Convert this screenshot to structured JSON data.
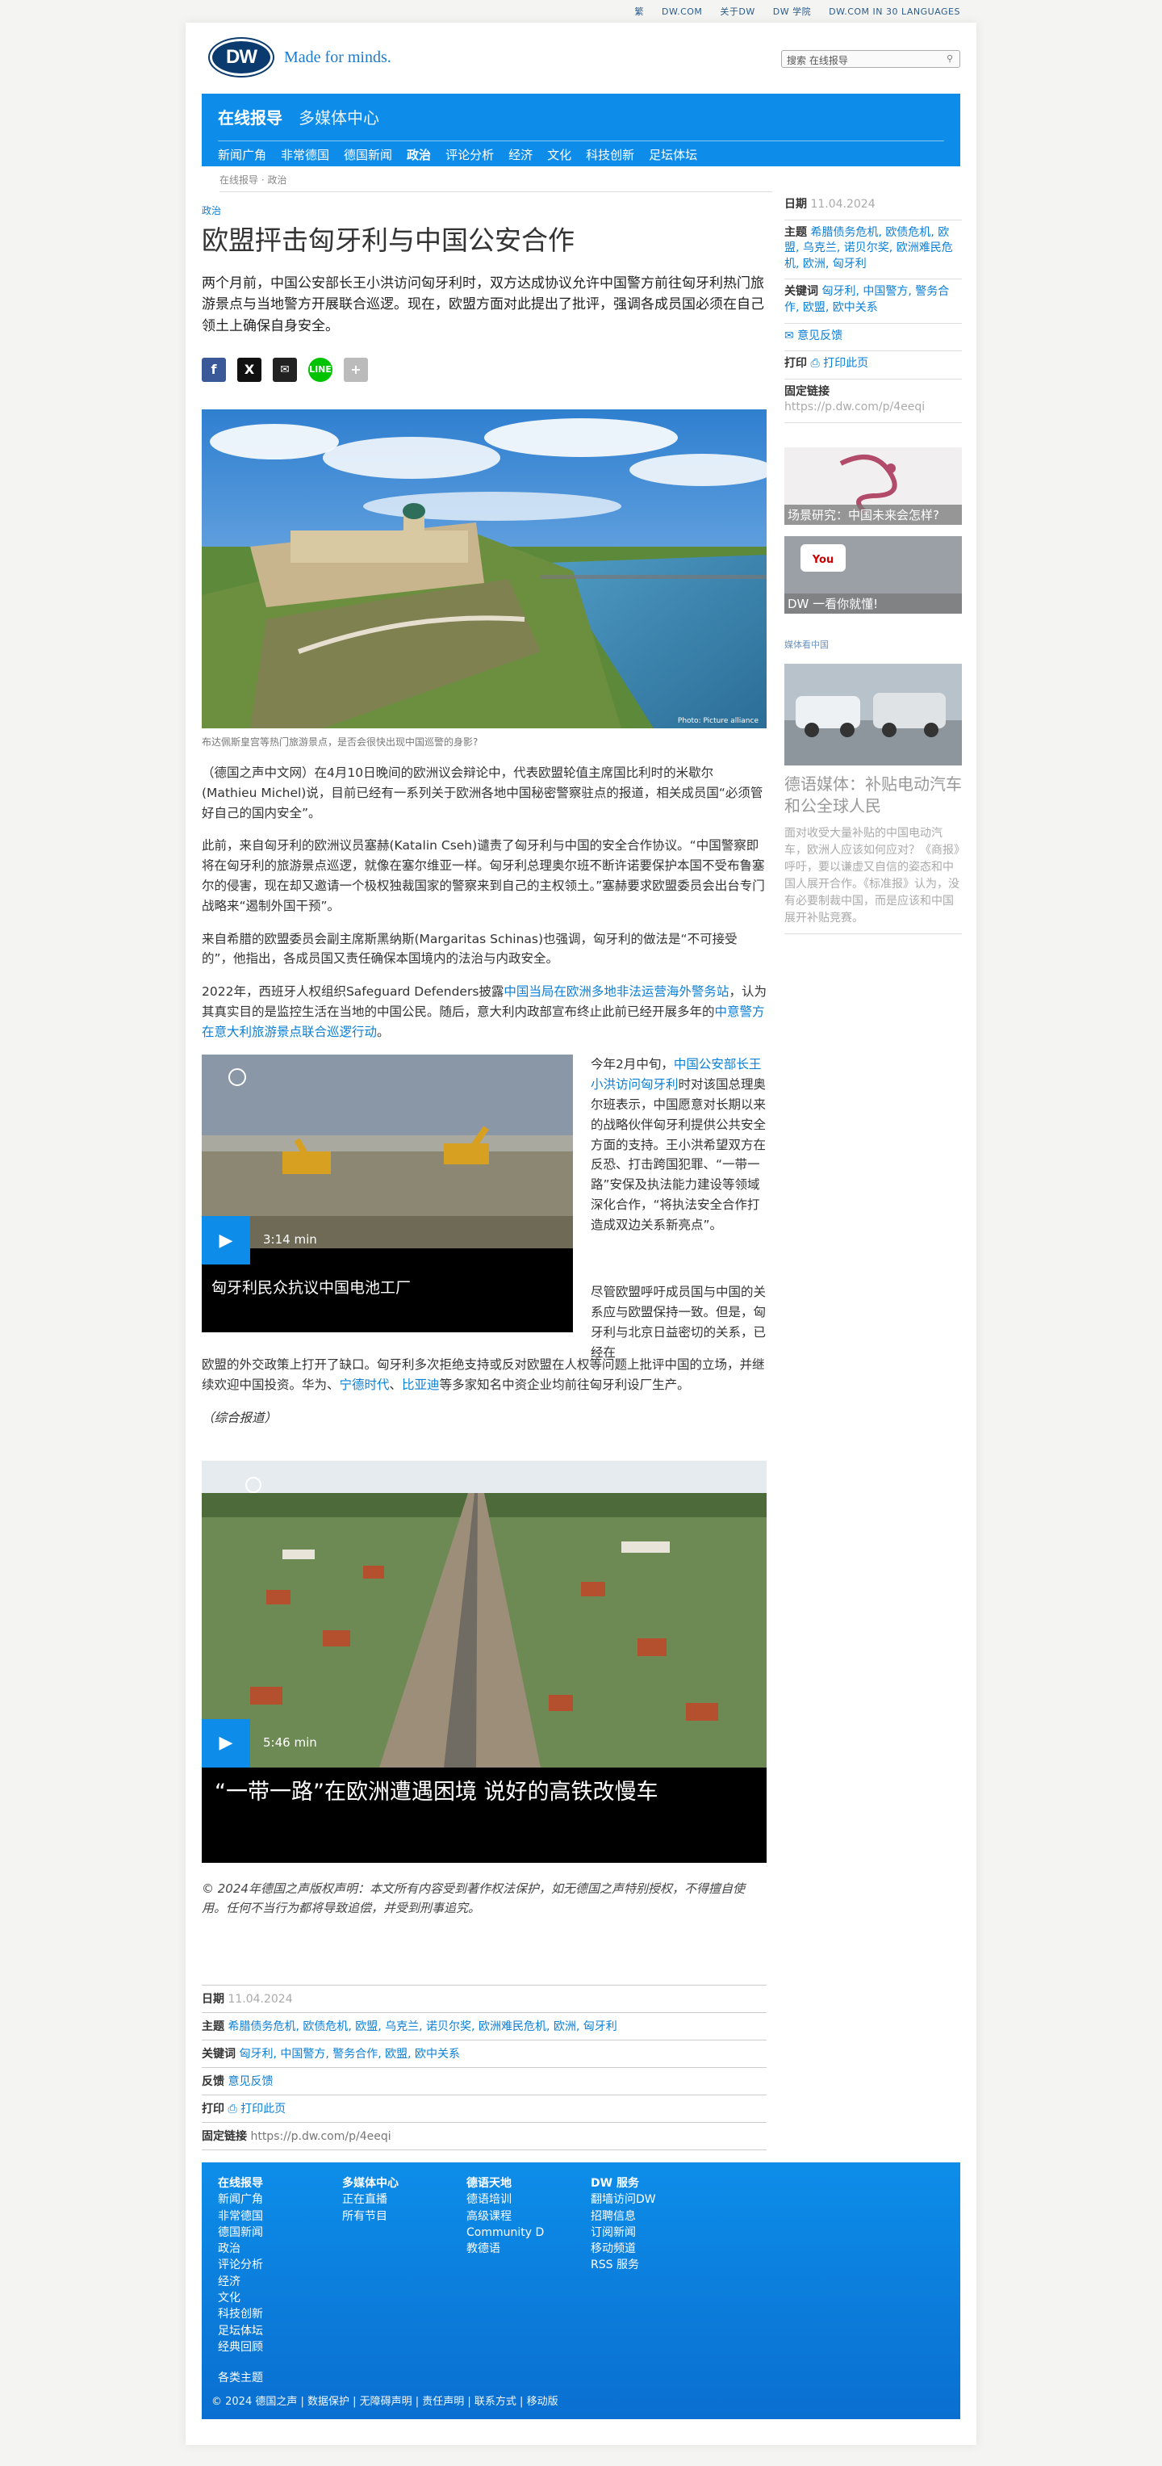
{
  "topbar": {
    "l1": "繁",
    "l2": "DW.COM",
    "l3": "关于DW",
    "l4": "DW 学院",
    "l5": "DW.COM IN 30 LANGUAGES"
  },
  "header": {
    "logo": "DW",
    "tagline": "Made for minds.",
    "search_placeholder": "搜索 在线报导"
  },
  "nav": {
    "main": "在线报导",
    "media": "多媒体中心",
    "subs": [
      "新闻广角",
      "非常德国",
      "德国新闻",
      "政治",
      "评论分析",
      "经济",
      "文化",
      "科技创新",
      "足坛体坛"
    ]
  },
  "breadcrumb": "在线报导 · 政治",
  "article": {
    "kicker": "政治",
    "title": "欧盟抨击匈牙利与中国公安合作",
    "lead": "两个月前，中国公安部长王小洪访问匈牙利时，双方达成协议允许中国警方前往匈牙利热门旅游景点与当地警方开展联合巡逻。现在，欧盟方面对此提出了批评，强调各成员国必须在自己领土上确保自身安全。",
    "hero_caption": "布达佩斯皇宫等热门旅游景点，是否会很快出现中国巡警的身影?",
    "hero_credit": "Photo: Picture alliance",
    "p1": "（德国之声中文网）在4月10日晚间的欧洲议会辩论中，代表欧盟轮值主席国比利时的米歇尔(Mathieu Michel)说，目前已经有一系列关于欧洲各地中国秘密警察驻点的报道，相关成员国“必须管好自己的国内安全”。",
    "p2": "此前，来自匈牙利的欧洲议员塞赫(Katalin Cseh)谴责了匈牙利与中国的安全合作协议。“中国警察即将在匈牙利的旅游景点巡逻，就像在塞尔维亚一样。匈牙利总理奥尔班不断许诺要保护本国不受布鲁塞尔的侵害，现在却又邀请一个极权独裁国家的警察来到自己的主权领土。”塞赫要求欧盟委员会出台专门战略来“遏制外国干预”。",
    "p3": "来自希腊的欧盟委员会副主席斯黑纳斯(Margaritas Schinas)也强调，匈牙利的做法是“不可接受的”，他指出，各成员国又责任确保本国境内的法治与内政安全。",
    "p4a": "2022年，西班牙人权组织Safeguard Defenders披露",
    "p4link1": "中国当局在欧洲多地非法运营海外警务站",
    "p4b": "，认为其真实目的是监控生活在当地的中国公民。随后，意大利内政部宣布终止此前已经开展多年的",
    "p4link2": "中意警方在意大利旅游景点联合巡逻行动",
    "p4c": "。",
    "p5a": "今年2月中旬，",
    "p5link": "中国公安部长王小洪访问匈牙利",
    "p5b": "时对该国总理奥尔班表示，中国愿意对长期以来的战略伙伴匈牙利提供公共安全方面的支持。王小洪希望双方在反恐、打击跨国犯罪、“一带一路”安保及执法能力建设等领域深化合作，“将执法安全合作打造成双边关系新亮点”。",
    "p6a": "尽管欧盟呼吁成员国与中国的关系应与欧盟保持一致。但是，匈牙利与北京日益密切的关系，已经在欧盟的外交政策上打开了缺口。匈牙利多次拒绝支持或反对欧盟在人权等问题上批评中国的立场，并继续欢迎中国投资。华为、",
    "p6link1": "宁德时代",
    "p6sep": "、",
    "p6link2": "比亚迪",
    "p6b": "等多家知名中资企业均前往匈牙利设厂生产。",
    "p7": "（综合报道）",
    "video1": {
      "duration": "3:14 min",
      "title": "匈牙利民众抗议中国电池工厂"
    },
    "video2": {
      "duration": "5:46 min",
      "title": "“一带一路”在欧洲遭遇困境 说好的高铁改慢车"
    },
    "copyright": "© 2024年德国之声版权声明：本文所有内容受到著作权法保护，如无德国之声特别授权，不得擅自使用。任何不当行为都将导致追偿，并受到刑事追究。"
  },
  "meta": {
    "date_label": "日期",
    "date": "11.04.2024",
    "topics_label": "主题",
    "topics": "希腊债务危机, 欧债危机, 欧盟, 乌克兰, 诺贝尔奖, 欧洲难民危机, 欧洲, 匈牙利",
    "keywords_label": "关键词",
    "keywords": "匈牙利, 中国警方, 警务合作, 欧盟, 欧中关系",
    "feedback_label": "反馈",
    "feedback": "意见反馈",
    "print_label": "打印",
    "print": "⎙ 打印此页",
    "link_label": "固定链接",
    "link": "https://p.dw.com/p/4eeqi"
  },
  "sidebar": {
    "date_label": "日期",
    "date": "11.04.2024",
    "topics_label": "主题",
    "topics": "希腊债务危机, 欧债危机, 欧盟, 乌克兰, 诺贝尔奖, 欧洲难民危机, 欧洲, 匈牙利",
    "keywords_label": "关键词",
    "keywords": "匈牙利, 中国警方, 警务合作, 欧盟, 欧中关系",
    "feedback": "✉ 意见反馈",
    "print_label": "打印",
    "print": "⎙ 打印此页",
    "link_label": "固定链接",
    "link": "https://p.dw.com/p/4eeqi",
    "card1": "场景研究：中国未来会怎样?",
    "card2": "DW 一看你就懂!",
    "section": "媒体看中国",
    "card3_title": "德语媒体：补贴电动汽车和公全球人民",
    "card3_text": "面对收受大量补贴的中国电动汽车，欧洲人应该如何应对？《商报》呼吁，要以谦虚又自信的姿态和中国人展开合作。《标准报》认为，没有必要制裁中国，而是应该和中国展开补贴竞赛。"
  },
  "footer": {
    "col1_head": "在线报导",
    "col1": [
      "新闻广角",
      "非常德国",
      "德国新闻",
      "政治",
      "评论分析",
      "经济",
      "文化",
      "科技创新",
      "足坛体坛",
      "经典回顾"
    ],
    "col2_head": "多媒体中心",
    "col2": [
      "正在直播",
      "所有节目"
    ],
    "col3_head": "德语天地",
    "col3": [
      "德语培训",
      "高级课程",
      "Community D",
      "教德语"
    ],
    "col4_head": "DW 服务",
    "col4": [
      "翻墙访问DW",
      "招聘信息",
      "订阅新闻",
      "移动频道",
      "RSS 服务"
    ],
    "topics": "各类主题",
    "bottom": "© 2024 德国之声 | 数据保护 | 无障碍声明 | 责任声明 | 联系方式 | 移动版"
  },
  "colors": {
    "brand": "#0d8de9",
    "link": "#0b7fd6",
    "dark_blue": "#0a3a6e"
  }
}
